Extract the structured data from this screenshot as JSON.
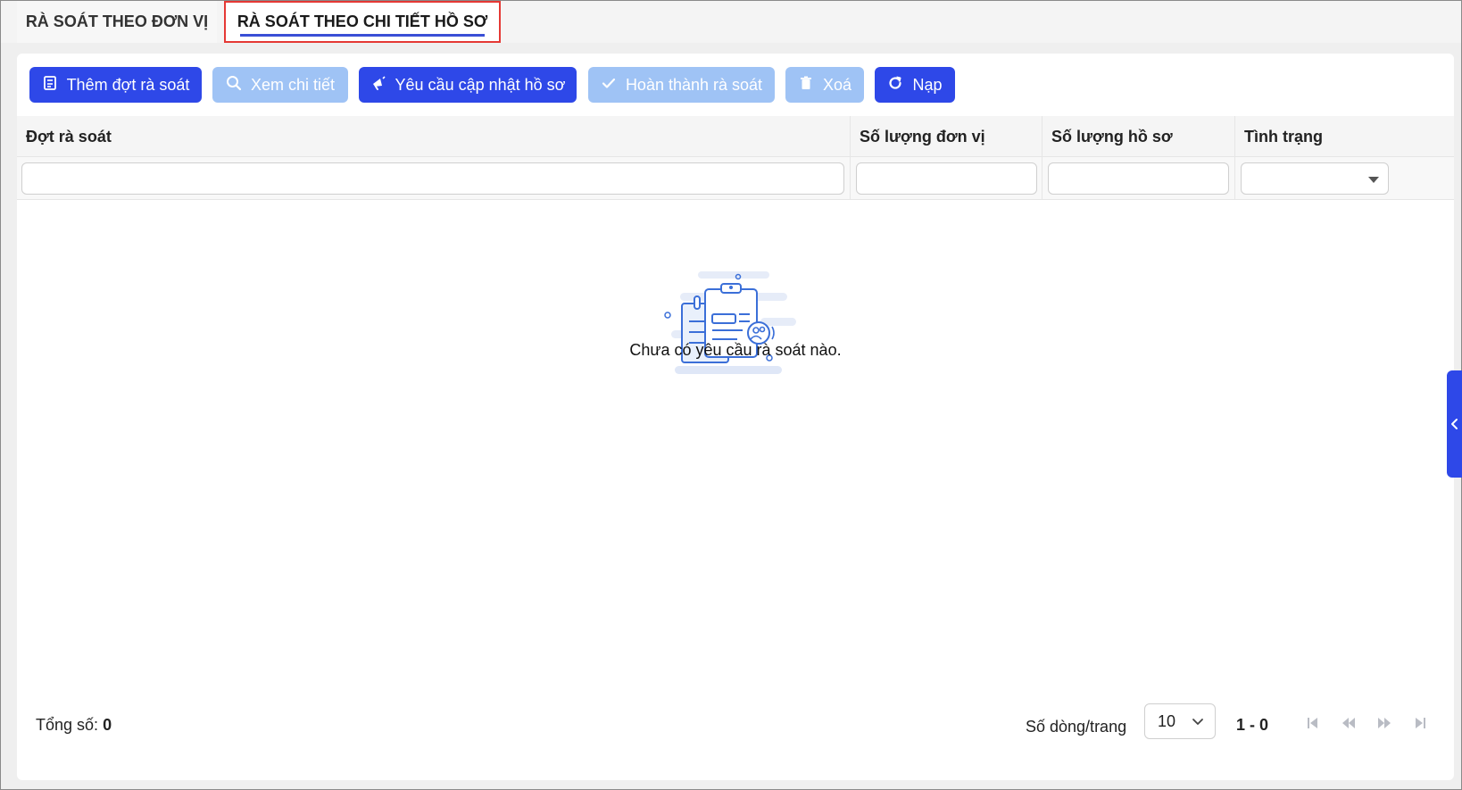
{
  "tabs": [
    {
      "label": "RÀ SOÁT THEO ĐƠN VỊ",
      "active": false
    },
    {
      "label": "RÀ SOÁT THEO CHI TIẾT HỒ SƠ",
      "active": true
    }
  ],
  "toolbar": {
    "add_label": "Thêm đợt rà soát",
    "view_label": "Xem chi tiết",
    "request_label": "Yêu cầu cập nhật hồ sơ",
    "complete_label": "Hoàn thành rà soát",
    "delete_label": "Xoá",
    "reload_label": "Nạp"
  },
  "table": {
    "columns": [
      "Đợt rà soát",
      "Số lượng đơn vị",
      "Số lượng hồ sơ",
      "Tình trạng"
    ],
    "empty_message": "Chưa có yêu cầu rà soát nào."
  },
  "footer": {
    "total_label": "Tổng số:",
    "total_value": "0",
    "rows_per_page_label": "Số dòng/trang",
    "rows_per_page_value": "10",
    "range": "1 - 0"
  },
  "colors": {
    "primary": "#2e48e8",
    "disabled": "#9fc3f5",
    "active_tab_outline": "#e53935"
  },
  "icons": [
    "book-icon",
    "search-icon",
    "megaphone-icon",
    "check-icon",
    "trash-icon",
    "refresh-icon",
    "chevron-down-icon",
    "first-page-icon",
    "prev-page-icon",
    "next-page-icon",
    "last-page-icon",
    "chevron-left-icon"
  ]
}
